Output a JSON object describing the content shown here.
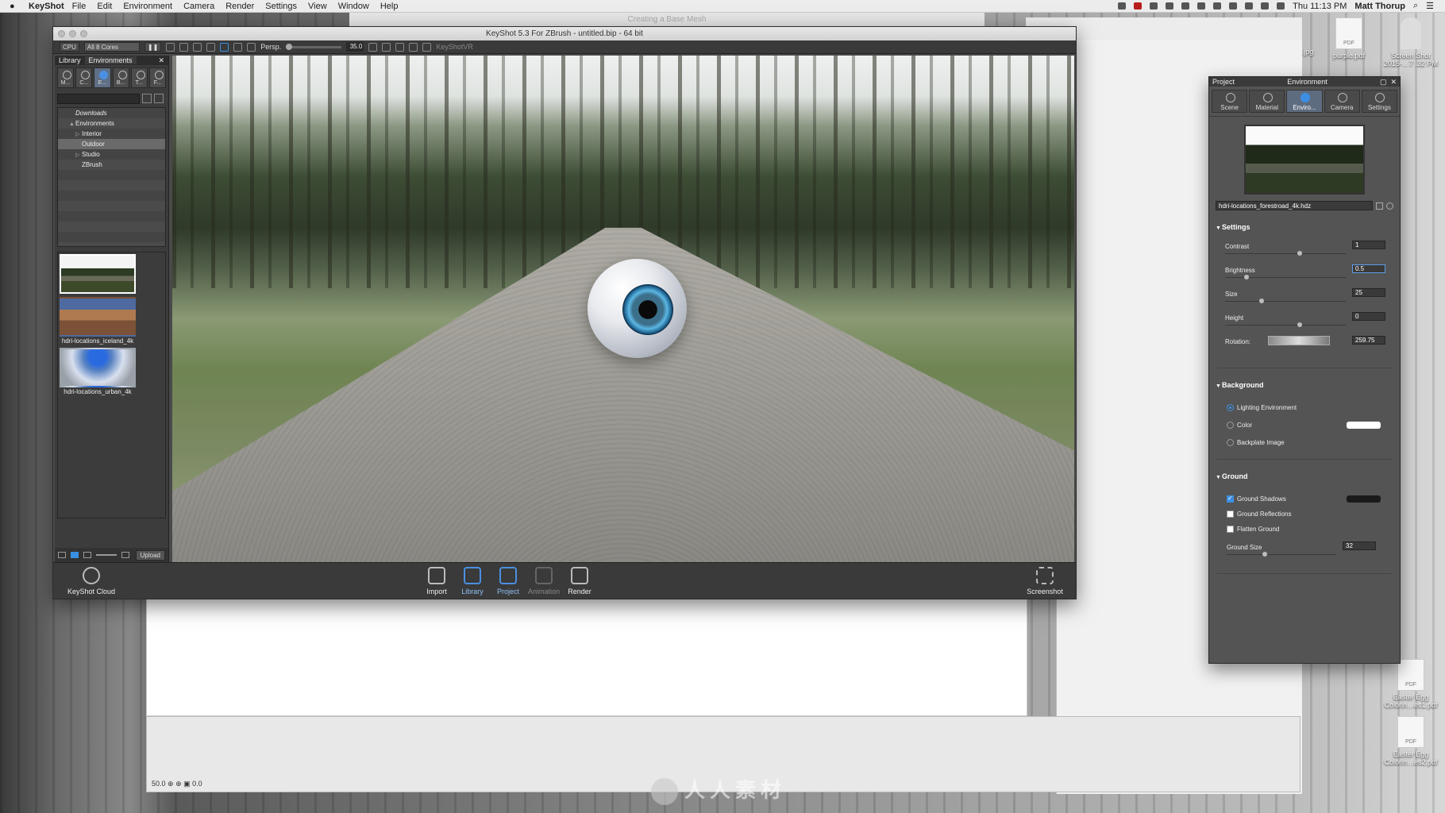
{
  "menubar": {
    "app": "KeyShot",
    "items": [
      "File",
      "Edit",
      "Environment",
      "Camera",
      "Render",
      "Settings",
      "View",
      "Window",
      "Help"
    ],
    "clock": "Thu 11:13 PM",
    "user": "Matt Thorup"
  },
  "desktop": {
    "background_window_title": "Creating a Base Mesh",
    "icons": [
      "purple.pdf",
      "Screen Shot 2015-…7 .32 PM",
      "Easter Egg Colorin…es1.pdf",
      "Easter Egg Colorin…es2.pdf",
      ".jpg"
    ],
    "ruler_value": "50.0",
    "ruler_value2": "0.0"
  },
  "window": {
    "title": "KeyShot 5.3 For ZBrush - untitled.bip  - 64 bit"
  },
  "toolbar": {
    "cpu_label": "CPU",
    "cores": "All 8 Cores",
    "perspective": "Persp.",
    "fov": "35.0",
    "vr_label": "KeyShotVR"
  },
  "library": {
    "tabs": [
      "Library",
      "Environments"
    ],
    "categories": [
      "M...",
      "C...",
      "E...",
      "B...",
      "T...",
      "F..."
    ],
    "active_category": "E...",
    "search_placeholder": "",
    "tree": [
      {
        "label": "Downloads",
        "head": true
      },
      {
        "label": "Environments",
        "twisty": "▲"
      },
      {
        "label": "Interior",
        "twisty": "▷",
        "indent": true
      },
      {
        "label": "Outdoor",
        "indent": true,
        "selected": true
      },
      {
        "label": "Studio",
        "twisty": "▷",
        "indent": true
      },
      {
        "label": "ZBrush",
        "indent": true
      }
    ],
    "thumbnails": [
      {
        "name": "",
        "style": "forest",
        "selected": true
      },
      {
        "name": "hdri-locations_iceland_4k",
        "style": "iceland"
      },
      {
        "name": "hdri-locations_urban_4k",
        "style": "urban"
      }
    ],
    "upload_label": "Upload"
  },
  "dock": {
    "cloud": "KeyShot Cloud",
    "items": [
      {
        "label": "Import",
        "state": "normal"
      },
      {
        "label": "Library",
        "state": "active"
      },
      {
        "label": "Project",
        "state": "active"
      },
      {
        "label": "Animation",
        "state": "dim"
      },
      {
        "label": "Render",
        "state": "normal"
      }
    ],
    "screenshot": "Screenshot"
  },
  "project": {
    "panel_label": "Project",
    "title": "Environment",
    "tabs": [
      "Scene",
      "Material",
      "Enviro...",
      "Camera",
      "Settings"
    ],
    "active_tab": "Enviro...",
    "hdri_file": "hdri-locations_forestroad_4k.hdz",
    "settings": {
      "head": "Settings",
      "contrast_label": "Contrast",
      "contrast": "1",
      "contrast_level": 0.62,
      "brightness_label": "Brightness",
      "brightness": "0.5",
      "brightness_level": 0.18,
      "size_label": "Size",
      "size": "25",
      "size_level": 0.3,
      "height_label": "Height",
      "height": "0",
      "height_level": 0.62,
      "rotation_label": "Rotation:",
      "rotation": "259.75"
    },
    "background": {
      "head": "Background",
      "options": [
        "Lighting Environment",
        "Color",
        "Backplate Image"
      ],
      "selected": "Lighting Environment",
      "color_swatch": "#ffffff"
    },
    "ground": {
      "head": "Ground",
      "shadows_label": "Ground Shadows",
      "shadows": true,
      "shadow_color": "#1a1a1a",
      "reflections_label": "Ground Reflections",
      "reflections": false,
      "flatten_label": "Flatten Ground",
      "flatten": false,
      "size_label": "Ground Size",
      "size": "32",
      "size_level": 0.35
    }
  },
  "colors": {
    "accent": "#3d8fe4",
    "panel": "#545454",
    "toolbar": "#3a3a3a"
  },
  "watermark": "人人素材"
}
